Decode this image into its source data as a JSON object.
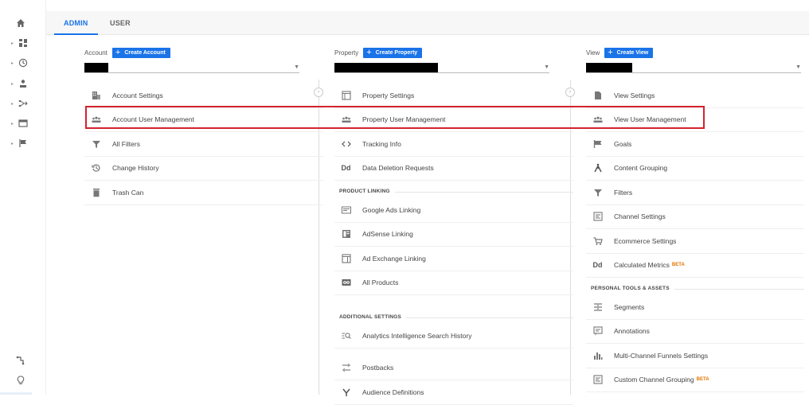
{
  "tabs": {
    "admin": "ADMIN",
    "user": "USER"
  },
  "account": {
    "label": "Account",
    "create": "Create Account",
    "items": [
      "Account Settings",
      "Account User Management",
      "All Filters",
      "Change History",
      "Trash Can"
    ]
  },
  "property": {
    "label": "Property",
    "create": "Create Property",
    "items": [
      "Property Settings",
      "Property User Management",
      "Tracking Info",
      "Data Deletion Requests"
    ],
    "section_product": "PRODUCT LINKING",
    "product_items": [
      "Google Ads Linking",
      "AdSense Linking",
      "Ad Exchange Linking",
      "All Products"
    ],
    "section_additional": "ADDITIONAL SETTINGS",
    "additional_items": [
      "Analytics Intelligence Search History",
      "Postbacks",
      "Audience Definitions"
    ]
  },
  "view": {
    "label": "View",
    "create": "Create View",
    "items": [
      "View Settings",
      "View User Management",
      "Goals",
      "Content Grouping",
      "Filters",
      "Channel Settings",
      "Ecommerce Settings",
      "Calculated Metrics"
    ],
    "beta": "BETA",
    "section_personal": "PERSONAL TOOLS & ASSETS",
    "personal_items": [
      "Segments",
      "Annotations",
      "Multi-Channel Funnels Settings",
      "Custom Channel Grouping"
    ]
  },
  "colors": {
    "accent": "#1a73e8",
    "highlight": "#d3232f"
  }
}
